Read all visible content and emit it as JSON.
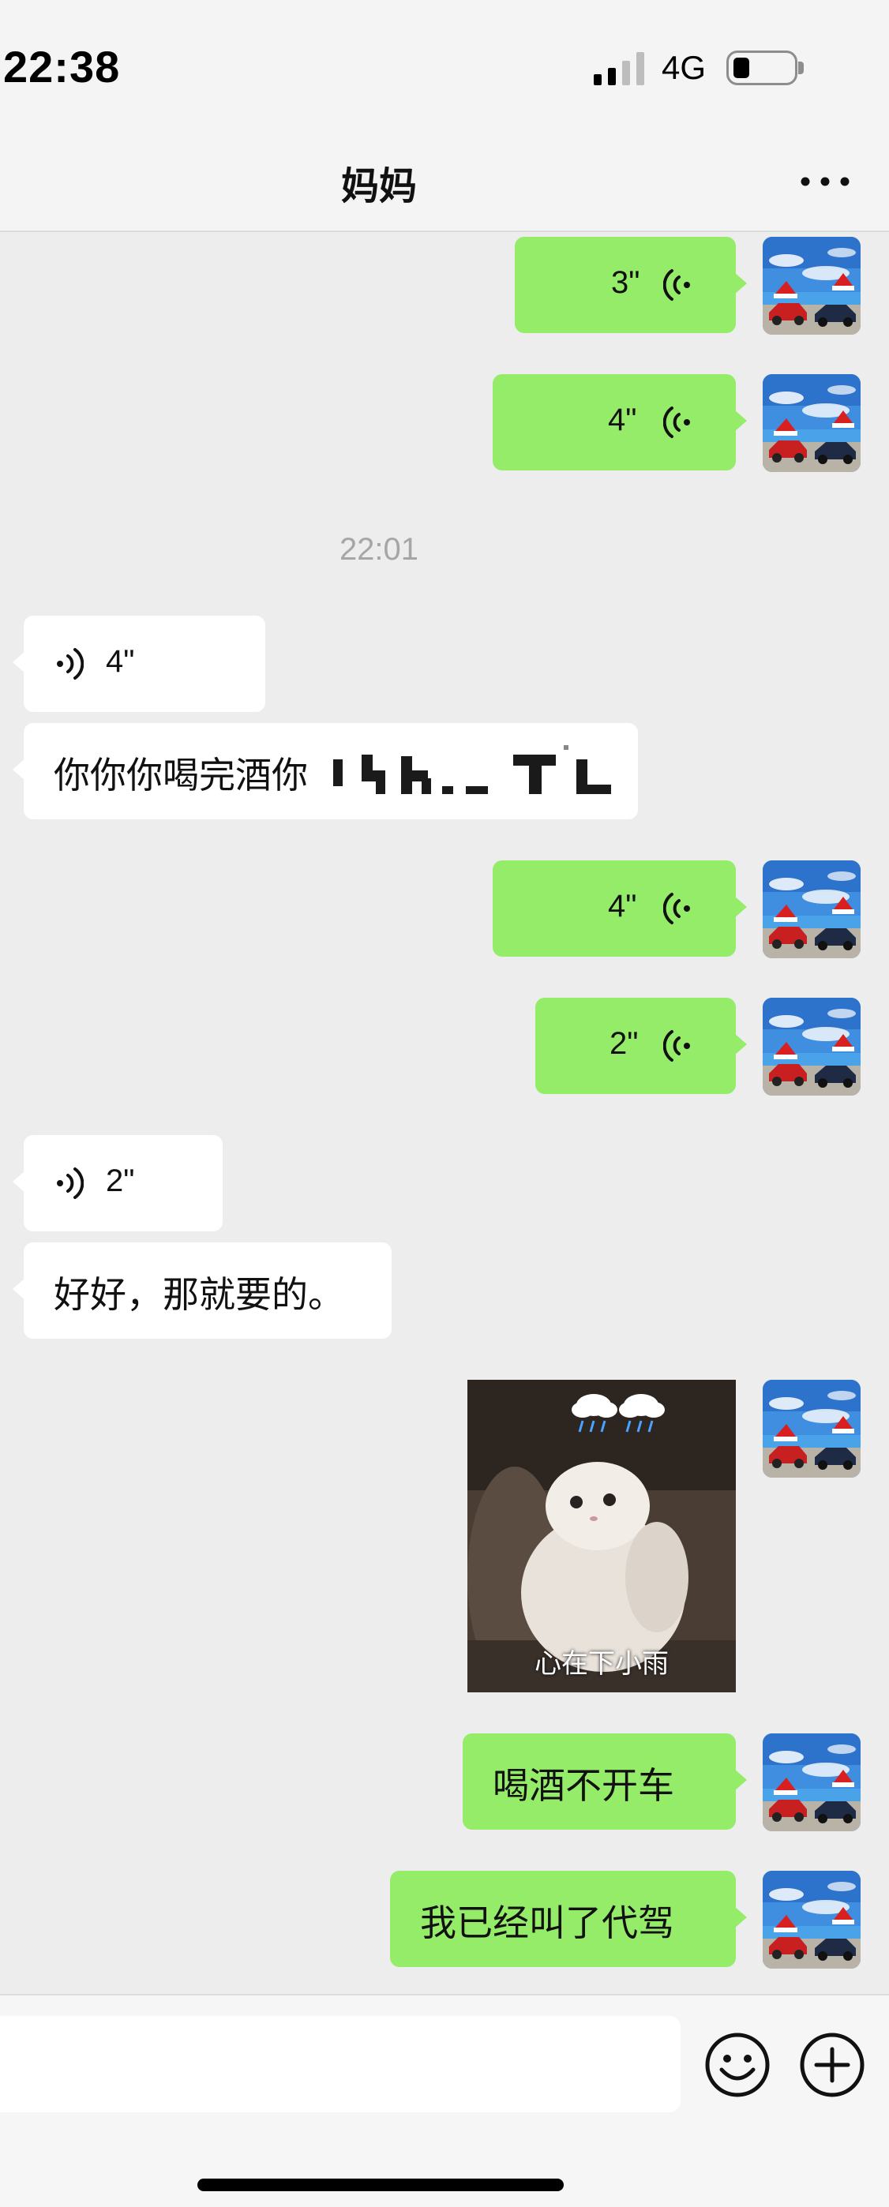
{
  "status_bar": {
    "time": "22:38",
    "network": "4G",
    "signal_bars": 2,
    "battery_level": 0.2
  },
  "header": {
    "title": "妈妈",
    "more_icon": "more-icon"
  },
  "messages": {
    "m1": {
      "duration": "3\""
    },
    "m2": {
      "duration": "4\""
    },
    "time_divider": "22:01",
    "m3": {
      "duration": "4\""
    },
    "m4": {
      "text": "你你你喝完酒你"
    },
    "m5": {
      "duration": "4\""
    },
    "m6": {
      "duration": "2\""
    },
    "m7": {
      "duration": "2\""
    },
    "m8": {
      "text": "好好，那就要的。"
    },
    "m9": {
      "sticker_caption": "心在下小雨"
    },
    "m10": {
      "text": "喝酒不开车"
    },
    "m11": {
      "text": "我已经叫了代驾"
    }
  },
  "input_bar": {
    "placeholder": "",
    "emoji_icon": "emoji-icon",
    "plus_icon": "plus-icon"
  },
  "colors": {
    "sent_bubble": "#95ec69",
    "received_bubble": "#ffffff",
    "background": "#ededed"
  }
}
